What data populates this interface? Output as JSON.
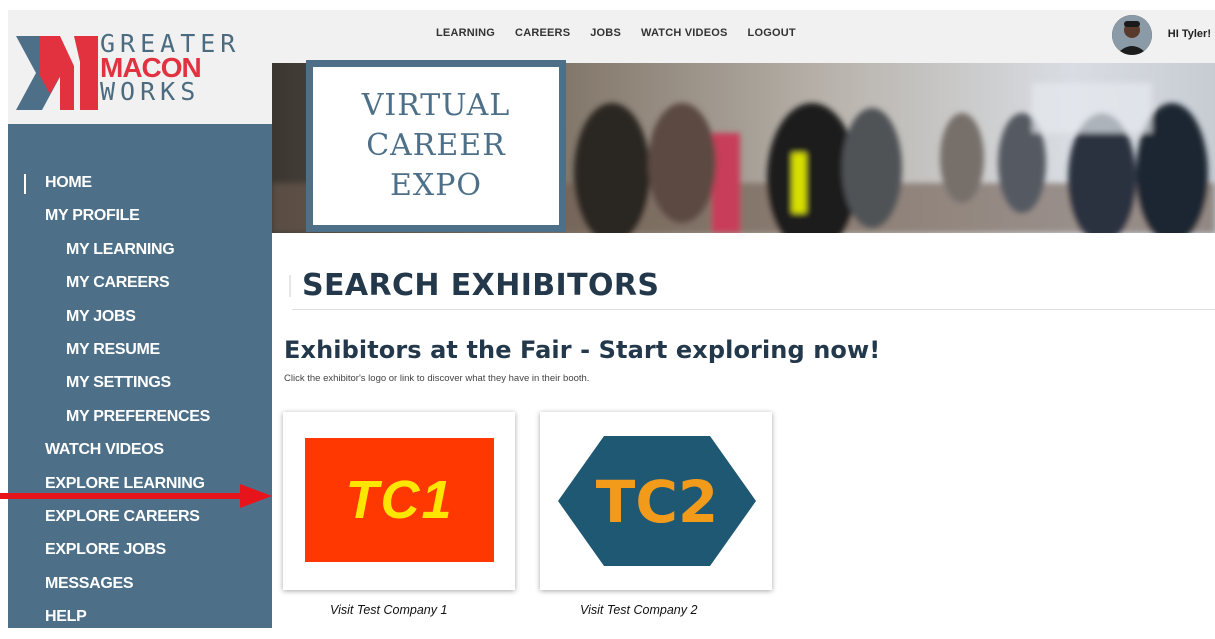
{
  "brand": {
    "logo_lines": [
      "GREATER",
      "MACON",
      "WORKS"
    ],
    "colors": {
      "primary": "#4d7088",
      "accent": "#e23240",
      "title": "#23384a"
    }
  },
  "topnav": {
    "items": [
      "LEARNING",
      "CAREERS",
      "JOBS",
      "WATCH VIDEOS",
      "LOGOUT"
    ],
    "greeting": "HI Tyler!",
    "avatar_icon": "user-avatar"
  },
  "hero": {
    "title_lines": [
      "VIRTUAL",
      "CAREER",
      "EXPO"
    ]
  },
  "sidebar": {
    "items": [
      {
        "label": "HOME",
        "level": 0,
        "active": true
      },
      {
        "label": "MY PROFILE",
        "level": 0
      },
      {
        "label": "MY LEARNING",
        "level": 1
      },
      {
        "label": "MY CAREERS",
        "level": 1
      },
      {
        "label": "MY JOBS",
        "level": 1
      },
      {
        "label": "MY RESUME",
        "level": 1
      },
      {
        "label": "MY SETTINGS",
        "level": 1
      },
      {
        "label": "MY PREFERENCES",
        "level": 1
      },
      {
        "label": "WATCH VIDEOS",
        "level": 0
      },
      {
        "label": "EXPLORE LEARNING",
        "level": 0
      },
      {
        "label": "EXPLORE CAREERS",
        "level": 0
      },
      {
        "label": "EXPLORE JOBS",
        "level": 0
      },
      {
        "label": "MESSAGES",
        "level": 0
      },
      {
        "label": "HELP",
        "level": 0
      }
    ]
  },
  "main": {
    "section_title": "SEARCH EXHIBITORS",
    "subheading": "Exhibitors at the Fair - Start exploring now!",
    "intro": "Click the exhibitor's logo or link to discover what they have in their booth.",
    "exhibitors": [
      {
        "logo_text": "TC1",
        "link": "Visit Test Company 1",
        "logo_bg": "#ff3700",
        "logo_fg": "#ffe600"
      },
      {
        "logo_text": "TC2",
        "link": "Visit Test Company 2",
        "logo_bg": "#1f5872",
        "logo_fg": "#f29a1a"
      }
    ]
  },
  "annotation": {
    "arrow_color": "#e8141c",
    "arrow_icon": "arrow-right"
  }
}
